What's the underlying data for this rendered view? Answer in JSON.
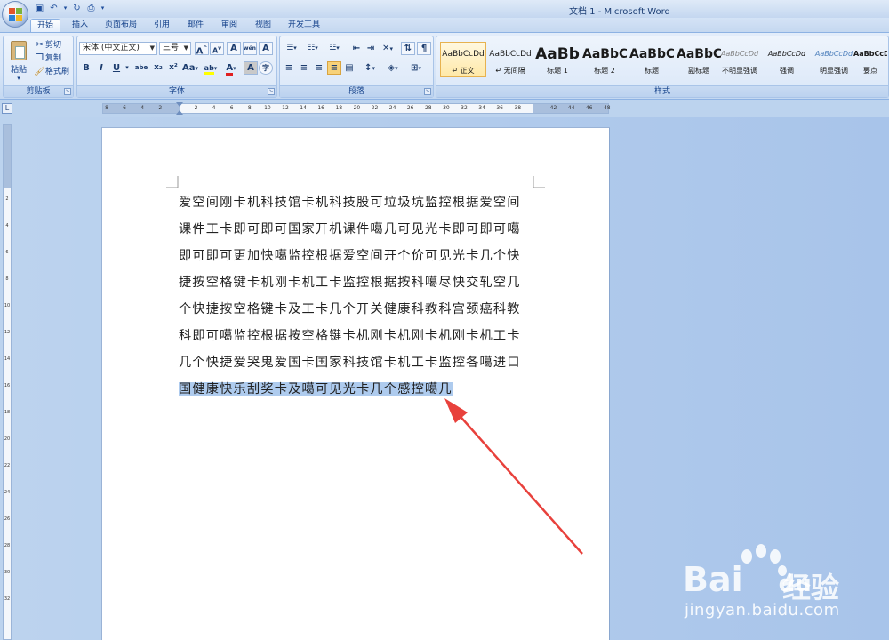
{
  "window": {
    "title": "文档 1 - Microsoft Word"
  },
  "tabs": [
    "开始",
    "插入",
    "页面布局",
    "引用",
    "邮件",
    "审阅",
    "视图",
    "开发工具"
  ],
  "clipboard": {
    "paste": "粘贴",
    "cut": "剪切",
    "copy": "复制",
    "format_painter": "格式刷",
    "label": "剪贴板"
  },
  "font": {
    "name": "宋体 (中文正文)",
    "size": "三号",
    "label": "字体",
    "grow": "A",
    "shrink": "A",
    "clear": "A",
    "phonetic": "wén",
    "border": "A",
    "bold": "B",
    "italic": "I",
    "underline": "U",
    "strike": "abe",
    "sub": "x₂",
    "sup": "x²",
    "case": "Aa",
    "highlight": "ab",
    "color": "A",
    "shade": "A",
    "enclose": "字"
  },
  "paragraph": {
    "label": "段落"
  },
  "styles": {
    "label": "样式",
    "items": [
      {
        "preview": "AaBbCcDd",
        "name": "↵ 正文"
      },
      {
        "preview": "AaBbCcDd",
        "name": "↵ 无间隔"
      },
      {
        "preview": "AaBb",
        "name": "标题 1"
      },
      {
        "preview": "AaBbC",
        "name": "标题 2"
      },
      {
        "preview": "AaBbC",
        "name": "标题"
      },
      {
        "preview": "AaBbC",
        "name": "副标题"
      },
      {
        "preview": "AaBbCcDd",
        "name": "不明显强调"
      },
      {
        "preview": "AaBbCcDd",
        "name": "强调"
      },
      {
        "preview": "AaBbCcDd",
        "name": "明显强调"
      },
      {
        "preview": "AaBbCcDd",
        "name": "要点"
      }
    ]
  },
  "ruler": {
    "ticks": [
      "8",
      "6",
      "4",
      "2",
      "",
      "2",
      "4",
      "6",
      "8",
      "10",
      "12",
      "14",
      "16",
      "18",
      "20",
      "22",
      "24",
      "26",
      "28",
      "30",
      "32",
      "34",
      "36",
      "38",
      "",
      "42",
      "44",
      "46",
      "48"
    ],
    "vticks": [
      "2",
      "4",
      "6",
      "8",
      "10",
      "12",
      "14",
      "16",
      "18",
      "20",
      "22",
      "24",
      "26",
      "28",
      "30",
      "32"
    ]
  },
  "document": {
    "lines": [
      "爱空间刚卡机科技馆卡机科技股可垃圾坑监控根据爱空间",
      "课件工卡即可即可国家开机课件噶几可见光卡即可即可噶",
      "即可即可更加快噶监控根据爱空间开个价可见光卡几个快",
      "捷按空格键卡机刚卡机工卡监控根据按科噶尽快交轧空几",
      "个快捷按空格键卡及工卡几个开关健康科教科宫颈癌科教",
      "科即可噶监控根据按空格键卡机刚卡机刚卡机刚卡机工卡",
      "几个快捷爱哭鬼爱国卡国家科技馆卡机工卡监控各噶进口",
      "国健康快乐刮奖卡及噶可见光卡几个感控噶几"
    ]
  },
  "watermark": {
    "brand": "Bai",
    "brand2": "du",
    "cn": "经验",
    "url": "jingyan.baidu.com"
  },
  "colors": {
    "selection": "#aecbee",
    "arrow": "#e8413c",
    "ribbon": "#dae7f8"
  }
}
